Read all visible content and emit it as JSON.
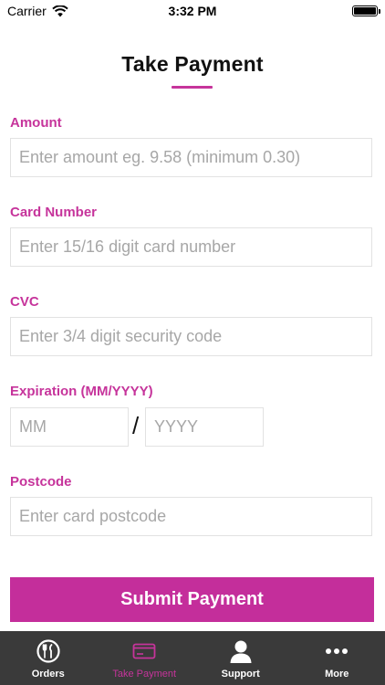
{
  "status_bar": {
    "carrier": "Carrier",
    "time": "3:32 PM"
  },
  "page": {
    "title": "Take Payment"
  },
  "form": {
    "amount": {
      "label": "Amount",
      "placeholder": "Enter amount eg. 9.58 (minimum 0.30)",
      "value": ""
    },
    "card_number": {
      "label": "Card Number",
      "placeholder": "Enter 15/16 digit card number",
      "value": ""
    },
    "cvc": {
      "label": "CVC",
      "placeholder": "Enter 3/4 digit security code",
      "value": ""
    },
    "expiration": {
      "label": "Expiration (MM/YYYY)",
      "month_placeholder": "MM",
      "year_placeholder": "YYYY",
      "separator": "/"
    },
    "postcode": {
      "label": "Postcode",
      "placeholder": "Enter card postcode",
      "value": ""
    },
    "submit_label": "Submit Payment"
  },
  "tab_bar": {
    "items": [
      {
        "label": "Orders",
        "icon": "plate-cutlery-icon",
        "active": false
      },
      {
        "label": "Take Payment",
        "icon": "credit-card-icon",
        "active": true
      },
      {
        "label": "Support",
        "icon": "person-icon",
        "active": false
      },
      {
        "label": "More",
        "icon": "more-dots-icon",
        "active": false
      }
    ]
  },
  "colors": {
    "accent": "#c6349b",
    "button": "#c42e9b",
    "tab_bar_bg": "#3a3a3a",
    "input_border": "#e2e2e2",
    "placeholder": "#a7a7a7"
  }
}
